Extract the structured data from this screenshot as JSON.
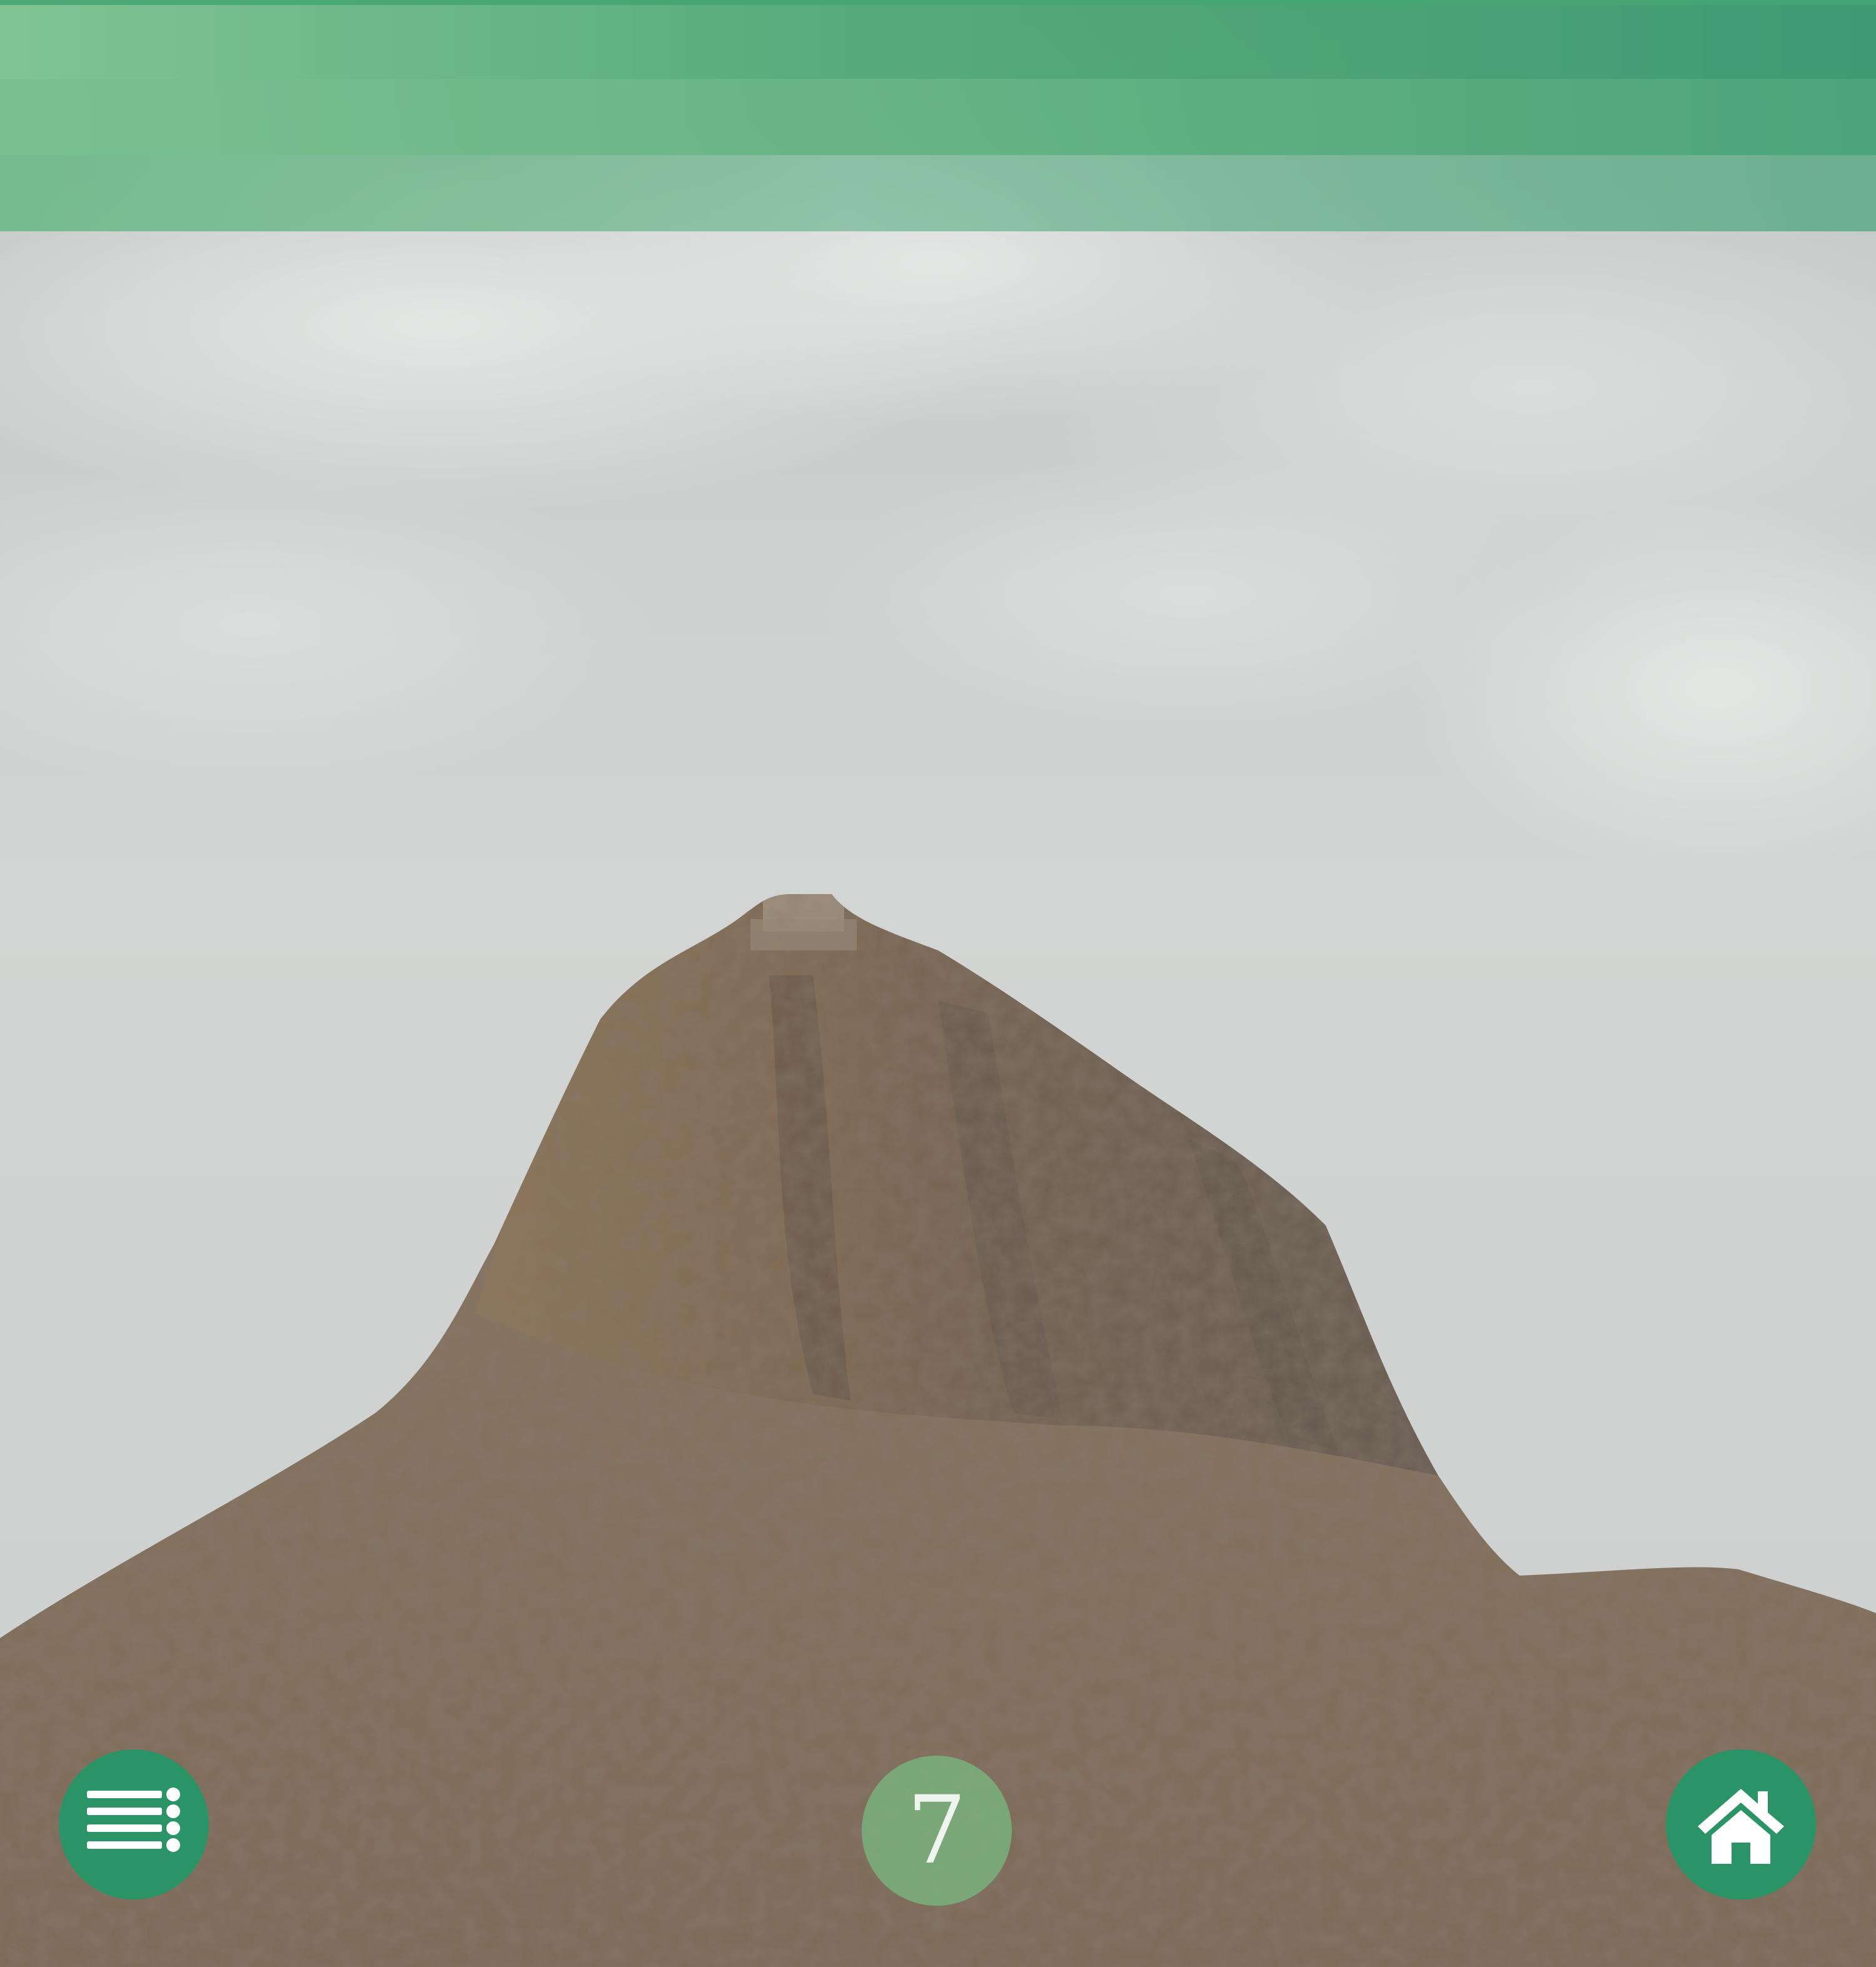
{
  "scene": {
    "subject": "mountain-photo"
  },
  "colors": {
    "accent": "#2a9467",
    "header_green": "#54aa7a",
    "indicator_green": "#78b982",
    "sky": "#c9cdcc",
    "rock": "#8a7560"
  },
  "navigation": {
    "menu_icon": "list-icon",
    "home_icon": "home-icon"
  },
  "pager": {
    "current_page": "7"
  }
}
